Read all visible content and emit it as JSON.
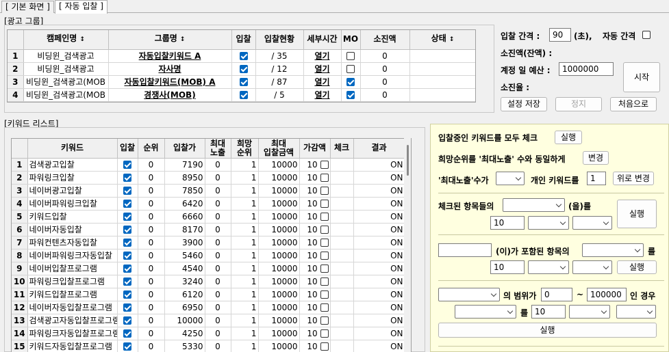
{
  "tabs": [
    {
      "label": "[ 기본 화면 ]",
      "active": false
    },
    {
      "label": "[ 자동 입찰 ]",
      "active": true
    }
  ],
  "ad_group": {
    "title": "[광고 그룹]",
    "columns": [
      "캠페인명",
      "그룹명",
      "입찰",
      "입찰현황",
      "세부시간",
      "MO",
      "소진액",
      "상태"
    ],
    "sort_icon": "↕",
    "rows": [
      {
        "num": "1",
        "campaign": "비딩윈_검색광고",
        "group": "자동입찰키워드 A",
        "bid": true,
        "status": "/ 35",
        "detail": "열기",
        "mo": false,
        "spent": "0",
        "state": ""
      },
      {
        "num": "2",
        "campaign": "비딩윈_검색광고",
        "group": "자사명",
        "bid": true,
        "status": "/ 12",
        "detail": "열기",
        "mo": false,
        "spent": "0",
        "state": ""
      },
      {
        "num": "3",
        "campaign": "비딩윈_검색광고(MOB",
        "group": "자동입찰키워드(MOB) A",
        "bid": true,
        "status": "/ 87",
        "detail": "열기",
        "mo": true,
        "spent": "0",
        "state": ""
      },
      {
        "num": "4",
        "campaign": "비딩윈_검색광고(MOB",
        "group": "경쟁사(MOB)",
        "bid": true,
        "status": "/ 5",
        "detail": "열기",
        "mo": true,
        "spent": "0",
        "state": ""
      }
    ]
  },
  "settings": {
    "interval_label": "입찰 간격 :",
    "interval_value": "90",
    "interval_unit": "(초),",
    "auto_interval_label": "자동 간격",
    "spent_label": "소진액(잔액) :",
    "daily_budget_label": "계정 일 예산 :",
    "daily_budget_value": "1000000",
    "spend_rate_label": "소진율 :",
    "start_button": "시작",
    "save_button": "설정 저장",
    "stop_button": "정지",
    "reset_button": "처음으로"
  },
  "keyword_list": {
    "title": "[키워드 리스트]",
    "columns": [
      "키워드",
      "입찰",
      "순위",
      "입찰가",
      "최대\n노출",
      "희망\n순위",
      "최대\n입찰금액",
      "가감액",
      "체크",
      "결과"
    ],
    "rows": [
      {
        "num": "1",
        "keyword": "검색광고입찰",
        "bid": true,
        "rank": "0",
        "price": "7190",
        "maxexp": "0",
        "hope": "1",
        "maxbid": "10000",
        "delta": "10",
        "check": false,
        "result": "ON"
      },
      {
        "num": "2",
        "keyword": "파워링크입찰",
        "bid": true,
        "rank": "0",
        "price": "8950",
        "maxexp": "0",
        "hope": "1",
        "maxbid": "10000",
        "delta": "10",
        "check": false,
        "result": "ON"
      },
      {
        "num": "3",
        "keyword": "네이버광고입찰",
        "bid": true,
        "rank": "0",
        "price": "7850",
        "maxexp": "0",
        "hope": "1",
        "maxbid": "10000",
        "delta": "10",
        "check": false,
        "result": "ON"
      },
      {
        "num": "4",
        "keyword": "네이버파워링크입찰",
        "bid": true,
        "rank": "0",
        "price": "6420",
        "maxexp": "0",
        "hope": "1",
        "maxbid": "10000",
        "delta": "10",
        "check": false,
        "result": "ON"
      },
      {
        "num": "5",
        "keyword": "키워드입찰",
        "bid": true,
        "rank": "0",
        "price": "6660",
        "maxexp": "0",
        "hope": "1",
        "maxbid": "10000",
        "delta": "10",
        "check": false,
        "result": "ON"
      },
      {
        "num": "6",
        "keyword": "네이버자동입찰",
        "bid": true,
        "rank": "0",
        "price": "8170",
        "maxexp": "0",
        "hope": "1",
        "maxbid": "10000",
        "delta": "10",
        "check": false,
        "result": "ON"
      },
      {
        "num": "7",
        "keyword": "파워컨텐츠자동입찰",
        "bid": true,
        "rank": "0",
        "price": "3900",
        "maxexp": "0",
        "hope": "1",
        "maxbid": "10000",
        "delta": "10",
        "check": false,
        "result": "ON"
      },
      {
        "num": "8",
        "keyword": "네이버파워링크자동입찰",
        "bid": true,
        "rank": "0",
        "price": "5460",
        "maxexp": "0",
        "hope": "1",
        "maxbid": "10000",
        "delta": "10",
        "check": false,
        "result": "ON"
      },
      {
        "num": "9",
        "keyword": "네이버입찰프로그램",
        "bid": true,
        "rank": "0",
        "price": "4540",
        "maxexp": "0",
        "hope": "1",
        "maxbid": "10000",
        "delta": "10",
        "check": false,
        "result": "ON"
      },
      {
        "num": "10",
        "keyword": "파워링크입찰프로그램",
        "bid": true,
        "rank": "0",
        "price": "3240",
        "maxexp": "0",
        "hope": "1",
        "maxbid": "10000",
        "delta": "10",
        "check": false,
        "result": "ON"
      },
      {
        "num": "11",
        "keyword": "키워드입찰프로그램",
        "bid": true,
        "rank": "0",
        "price": "6120",
        "maxexp": "0",
        "hope": "1",
        "maxbid": "10000",
        "delta": "10",
        "check": false,
        "result": "ON"
      },
      {
        "num": "12",
        "keyword": "네이버자동입찰프로그램",
        "bid": true,
        "rank": "0",
        "price": "6950",
        "maxexp": "0",
        "hope": "1",
        "maxbid": "10000",
        "delta": "10",
        "check": false,
        "result": "ON"
      },
      {
        "num": "13",
        "keyword": "검색광고자동입찰프로그램",
        "bid": true,
        "rank": "0",
        "price": "10000",
        "maxexp": "0",
        "hope": "1",
        "maxbid": "10000",
        "delta": "10",
        "check": false,
        "result": "ON"
      },
      {
        "num": "14",
        "keyword": "파워링크자동입찰프로그램",
        "bid": true,
        "rank": "0",
        "price": "4250",
        "maxexp": "0",
        "hope": "1",
        "maxbid": "10000",
        "delta": "10",
        "check": false,
        "result": "ON"
      },
      {
        "num": "15",
        "keyword": "키워드자동입찰프로그램",
        "bid": true,
        "rank": "0",
        "price": "5330",
        "maxexp": "0",
        "hope": "1",
        "maxbid": "10000",
        "delta": "10",
        "check": false,
        "result": "ON"
      }
    ]
  },
  "tools": {
    "check_all_label": "입찰중인 키워드를 모두 체크",
    "run_label": "실행",
    "hope_label": "희망순위를 '최대노출' 수와 동일하게",
    "change_label": "변경",
    "maxexp_label": "'최대노출'수가",
    "personal_label": "개인 키워드를",
    "personal_value": "1",
    "up_change_label": "위로 변경",
    "checked_items_label": "체크된 항목들의",
    "suffix_eul": "(을)를",
    "value_10": "10",
    "contains_label": "(이)가 포함된 항목의",
    "suffix_reul": "를",
    "range_label": "의 범위가",
    "range_from": "0",
    "tilde": "~",
    "range_to": "100000",
    "case_label": "인 경우",
    "reul_label": "를"
  }
}
